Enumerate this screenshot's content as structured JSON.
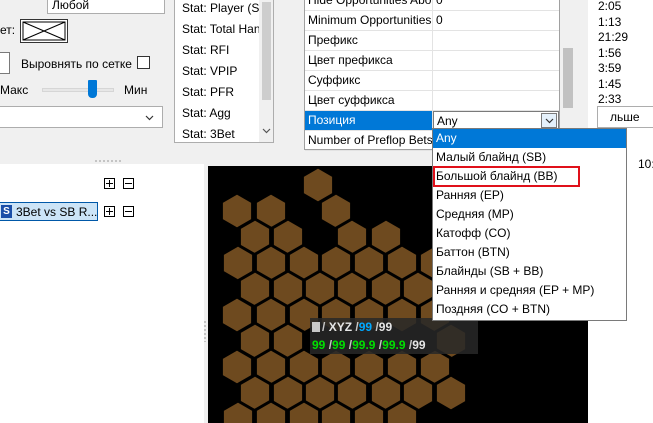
{
  "left_panel": {
    "any_combo": "Любой",
    "label_net": "ет:",
    "snap_label": "Выровнять по сетке",
    "max_label": "Макс",
    "min_label": "Мин"
  },
  "stats_list": [
    "Stat: Player (Sh",
    "Stat: Total Han",
    "Stat: RFI",
    "Stat: VPIP",
    "Stat: PFR",
    "Stat: Agg",
    "Stat: 3Bet"
  ],
  "props": {
    "rows": [
      {
        "label": "Hide Opportunities Abo",
        "value": "0"
      },
      {
        "label": "Minimum Opportunities",
        "value": "0"
      },
      {
        "label": "Префикс",
        "value": ""
      },
      {
        "label": "Цвет префикса",
        "value": ""
      },
      {
        "label": "Суффикс",
        "value": ""
      },
      {
        "label": "Цвет суффикса",
        "value": ""
      },
      {
        "label": "Позиция",
        "value": "Any"
      },
      {
        "label": "Number of Preflop Bets",
        "value": ""
      }
    ]
  },
  "dropdown": {
    "options": [
      "Any",
      "Малый блайнд (SB)",
      "Большой блайнд (BB)",
      "Ранняя (EP)",
      "Средняя (MP)",
      "Катофф (CO)",
      "Баттон (BTN)",
      "Блайнды (SB + BB)",
      "Ранняя и средняя (EP + MP)",
      "Поздняя (CO + BTN)"
    ],
    "selected": "Any",
    "highlighted": "Большой блайнд (BB)"
  },
  "right_times": [
    "2:05",
    "1:13",
    "21:29",
    "1:56",
    "3:59",
    "1:45",
    "2:33"
  ],
  "right_combo": "льше",
  "right_partial": "10:",
  "tree": {
    "node_label": "3Bet vs SB R...",
    "node_icon": "S"
  },
  "hud": {
    "line1": [
      "/",
      "XYZ",
      "/",
      "99",
      "/",
      "99"
    ],
    "line2": [
      "99",
      "/",
      "99",
      "/",
      "99.9",
      "/",
      "99.9",
      "/",
      "99"
    ]
  },
  "colors": {
    "selection": "#0078d7",
    "highlight_box": "#e0101a",
    "hex_fill": "#6e4a1f",
    "hud_cyan": "#00a8ff",
    "hud_green": "#00e000"
  }
}
